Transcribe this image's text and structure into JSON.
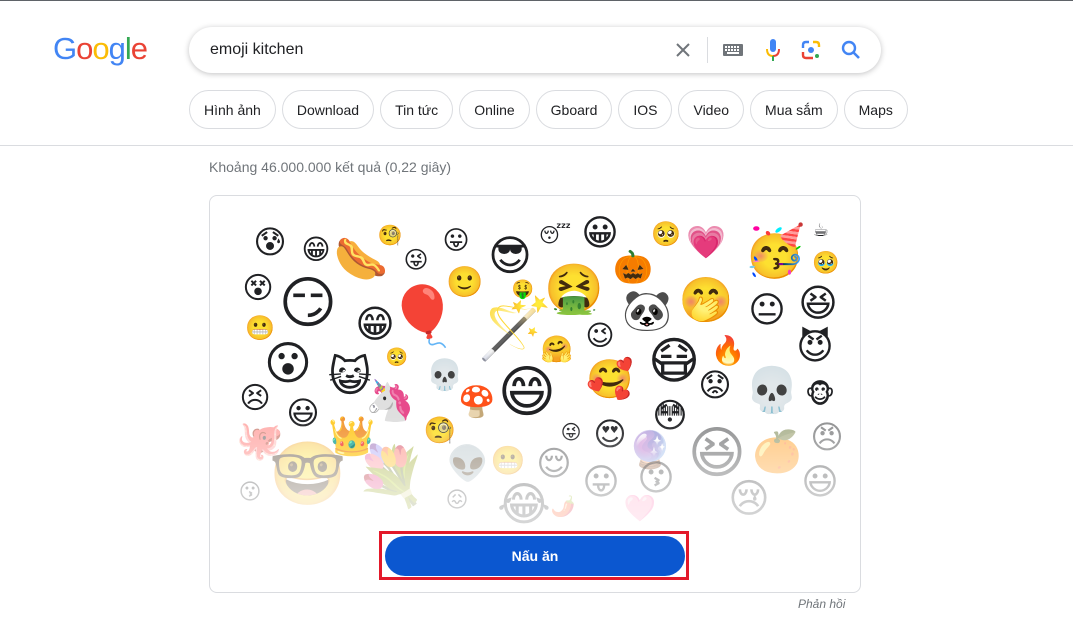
{
  "logo": {
    "letters": [
      "G",
      "o",
      "o",
      "g",
      "l",
      "e"
    ]
  },
  "search": {
    "query": "emoji kitchen",
    "icons": [
      "clear-icon",
      "keyboard-icon",
      "microphone-icon",
      "google-lens-icon",
      "search-icon"
    ]
  },
  "chips": [
    "Hình ảnh",
    "Download",
    "Tin tức",
    "Online",
    "Gboard",
    "IOS",
    "Video",
    "Mua sắm",
    "Maps"
  ],
  "results": {
    "stats": "Khoảng 46.000.000 kết quả (0,22 giây)"
  },
  "emoji_kitchen": {
    "button_label": "Nấu ăn",
    "feedback_label": "Phản hồi",
    "emojis": [
      {
        "g": "😰",
        "name": "anxious-face"
      },
      {
        "g": "😁",
        "name": "grin-heart"
      },
      {
        "g": "🌭",
        "name": "hotdog"
      },
      {
        "g": "🧐",
        "name": "one-eye"
      },
      {
        "g": "😛",
        "name": "tongue-face"
      },
      {
        "g": "😜",
        "name": "wink-tongue"
      },
      {
        "g": "😎",
        "name": "sunglasses"
      },
      {
        "g": "😴",
        "name": "sleepy"
      },
      {
        "g": "😀",
        "name": "flower-crown"
      },
      {
        "g": "🥺",
        "name": "pleading"
      },
      {
        "g": "💗",
        "name": "heart-face"
      },
      {
        "g": "🥳",
        "name": "party-blob"
      },
      {
        "g": "☕",
        "name": "coffee"
      },
      {
        "g": "🥹",
        "name": "holding-tears"
      },
      {
        "g": "😏",
        "name": "smirk-laugh"
      },
      {
        "g": "🎈",
        "name": "balloon-face"
      },
      {
        "g": "🙂",
        "name": "smile"
      },
      {
        "g": "🤑",
        "name": "money-face"
      },
      {
        "g": "🤮",
        "name": "vomit"
      },
      {
        "g": "🎃",
        "name": "pumpkin"
      },
      {
        "g": "😵",
        "name": "dizzy-grin"
      },
      {
        "g": "😬",
        "name": "grimace-small"
      },
      {
        "g": "😁",
        "name": "grin"
      },
      {
        "g": "🪄",
        "name": "magic-blob"
      },
      {
        "g": "🐼",
        "name": "panda"
      },
      {
        "g": "🤭",
        "name": "hand-mouth"
      },
      {
        "g": "😐",
        "name": "neutral"
      },
      {
        "g": "😆",
        "name": "smirk-grin"
      },
      {
        "g": "😮",
        "name": "open-mouth"
      },
      {
        "g": "🥺",
        "name": "tiny-pleading"
      },
      {
        "g": "😉",
        "name": "smirk-small"
      },
      {
        "g": "🤗",
        "name": "small-hug"
      },
      {
        "g": "😷",
        "name": "mask"
      },
      {
        "g": "🔥",
        "name": "fire"
      },
      {
        "g": "😈",
        "name": "devil"
      },
      {
        "g": "😺",
        "name": "cat"
      },
      {
        "g": "💀",
        "name": "skull-small"
      },
      {
        "g": "😄",
        "name": "big-grin"
      },
      {
        "g": "🥰",
        "name": "hearts-face"
      },
      {
        "g": "😟",
        "name": "worried-tri"
      },
      {
        "g": "💀",
        "name": "skull"
      },
      {
        "g": "🐵",
        "name": "monkey"
      },
      {
        "g": "😣",
        "name": "grimace"
      },
      {
        "g": "😃",
        "name": "smile-open"
      },
      {
        "g": "🦄",
        "name": "unicorn"
      },
      {
        "g": "🍄",
        "name": "mushroom"
      },
      {
        "g": "😳",
        "name": "flushed"
      },
      {
        "g": "🐙",
        "name": "octopus"
      },
      {
        "g": "👑",
        "name": "crown-face"
      },
      {
        "g": "🧐",
        "name": "monocle"
      },
      {
        "g": "😜",
        "name": "tongue-small"
      },
      {
        "g": "😍",
        "name": "heart-eyes"
      },
      {
        "g": "🔮",
        "name": "crystal-ball"
      },
      {
        "g": "😆",
        "name": "laugh-big"
      },
      {
        "g": "🍊",
        "name": "orange"
      },
      {
        "g": "😠",
        "name": "angry"
      },
      {
        "g": "😗",
        "name": "kiss-small"
      },
      {
        "g": "🤓",
        "name": "nerd"
      },
      {
        "g": "💐",
        "name": "bouquet"
      },
      {
        "g": "👽",
        "name": "alien"
      },
      {
        "g": "😬",
        "name": "grimace-2"
      },
      {
        "g": "😌",
        "name": "relieved"
      },
      {
        "g": "😛",
        "name": "tongue-out"
      },
      {
        "g": "😗",
        "name": "kiss"
      },
      {
        "g": "😂",
        "name": "rolling-laugh"
      },
      {
        "g": "🌶️",
        "name": "pepper"
      },
      {
        "g": "🩷",
        "name": "pink-heart"
      },
      {
        "g": "😢",
        "name": "crying-laugh"
      },
      {
        "g": "😃",
        "name": "grin-side"
      },
      {
        "g": "😖",
        "name": "tiny-squint"
      }
    ]
  }
}
